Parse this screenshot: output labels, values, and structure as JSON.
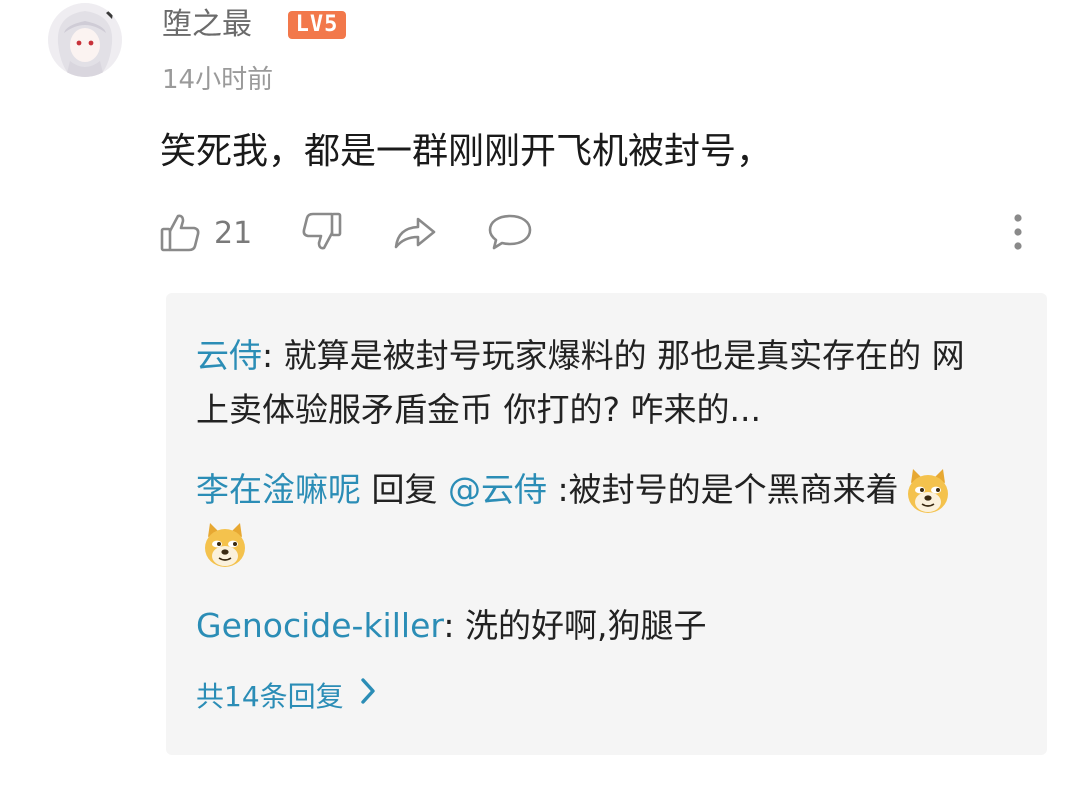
{
  "comment": {
    "username": "堕之最",
    "level": "LV5",
    "timestamp": "14小时前",
    "text": "笑死我，都是一群刚刚开飞机被封号，",
    "like_count": "21",
    "icons": {
      "like": "thumbs-up-icon",
      "dislike": "thumbs-down-icon",
      "share": "share-icon",
      "reply": "comment-icon",
      "more": "more-vertical-icon"
    }
  },
  "replies": {
    "items": [
      {
        "author": "云侍",
        "separator": ": ",
        "text": "就算是被封号玩家爆料的 那也是真实存在的 网上卖体验服矛盾金币 你打的? 咋来的..."
      },
      {
        "author": "李在淦嘛呢",
        "reply_word": " 回复 ",
        "mention": "@云侍",
        "text": " :被封号的是个黑商来着",
        "emoji": [
          "doge-emoji",
          "doge-emoji"
        ]
      },
      {
        "author": "Genocide-killer",
        "separator": ": ",
        "text": "洗的好啊,狗腿子"
      }
    ],
    "more_label": "共14条回复",
    "more_icon": "chevron-right-icon"
  },
  "colors": {
    "link": "#2b8db6",
    "badge": "#f2784b",
    "panel_bg": "#f5f5f5",
    "muted": "#9a9a9a"
  }
}
